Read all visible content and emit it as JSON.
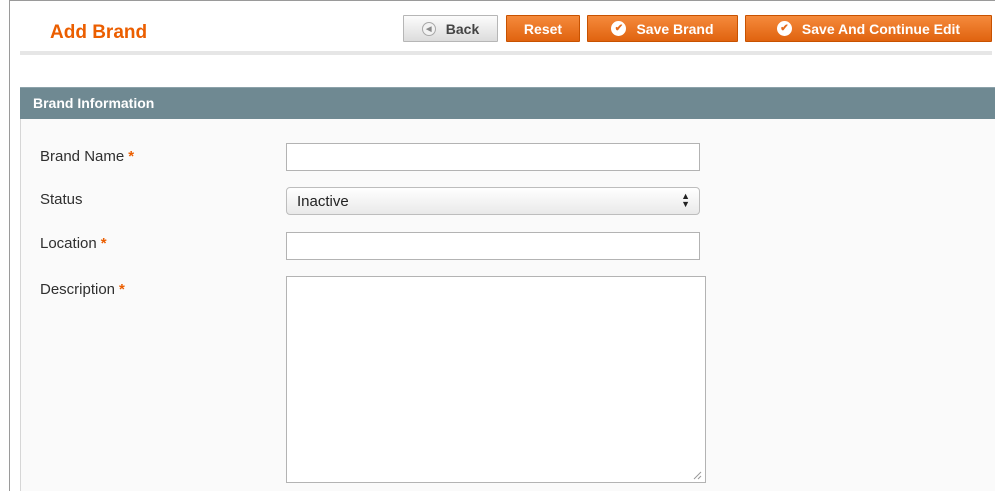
{
  "header": {
    "title": "Add Brand",
    "buttons": {
      "back": "Back",
      "reset": "Reset",
      "save": "Save Brand",
      "save_continue": "Save And Continue Edit"
    }
  },
  "section": {
    "title": "Brand Information"
  },
  "form": {
    "brand_name": {
      "label": "Brand Name",
      "required_mark": "*",
      "value": ""
    },
    "status": {
      "label": "Status",
      "value": "Inactive"
    },
    "location": {
      "label": "Location",
      "required_mark": "*",
      "value": ""
    },
    "description": {
      "label": "Description",
      "required_mark": "*",
      "value": ""
    }
  },
  "colors": {
    "accent": "#eb5e00",
    "button_orange": "#f07a2a",
    "section_bar": "#6f8992"
  },
  "icons": {
    "back": "back-arrow-icon",
    "save": "check-circle-icon",
    "save_continue": "check-circle-icon",
    "select": "select-arrows-icon",
    "resize": "resize-grip-icon"
  }
}
